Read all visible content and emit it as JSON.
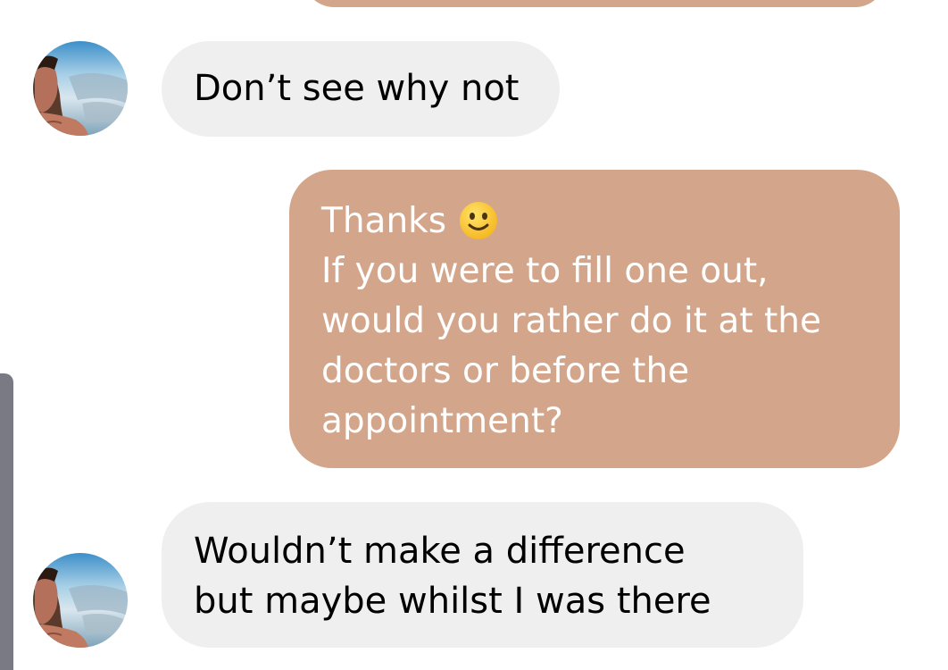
{
  "conversation": {
    "messages": [
      {
        "direction": "incoming",
        "lines": [
          "Don’t see why not"
        ]
      },
      {
        "direction": "outgoing",
        "lines": [
          "Thanks",
          "If you were to fill one out,",
          "would you rather do it at the",
          "doctors or before the",
          "appointment?"
        ],
        "emoji": "slightly-smiling-face-emoji"
      },
      {
        "direction": "incoming",
        "lines": [
          "Wouldn’t make a difference",
          "but maybe whilst I was there"
        ]
      }
    ]
  },
  "colors": {
    "outgoing_bubble": "#d3a68c",
    "incoming_bubble": "#efefef",
    "outgoing_text": "#ffffff",
    "incoming_text": "#000000"
  }
}
